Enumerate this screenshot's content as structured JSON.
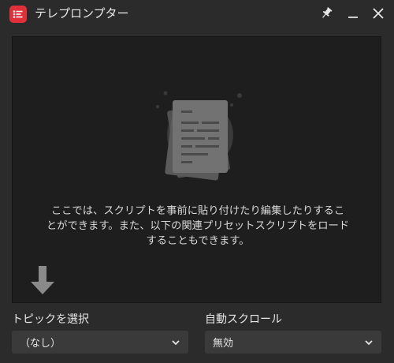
{
  "window": {
    "title": "テレプロンプター",
    "app_icon": "teleprompter-app-icon",
    "controls": [
      "pin-icon",
      "minimize-icon",
      "close-icon"
    ]
  },
  "script_area": {
    "illustration": "document-icon",
    "empty_message": "ここでは、スクリプトを事前に貼り付けたり編集したりするこ\nとができます。また、以下の関連プリセットスクリプトをロード\nすることもできます。",
    "load_indicator": "arrow-down-icon"
  },
  "topic": {
    "label": "トピックを選択",
    "value": "（なし）"
  },
  "auto_scroll": {
    "label": "自動スクロール",
    "value": "無効"
  },
  "colors": {
    "accent": "#e0313b",
    "background": "#2b2b2b",
    "script_background": "#1e1e1e",
    "select_background": "#3a3a3a"
  }
}
